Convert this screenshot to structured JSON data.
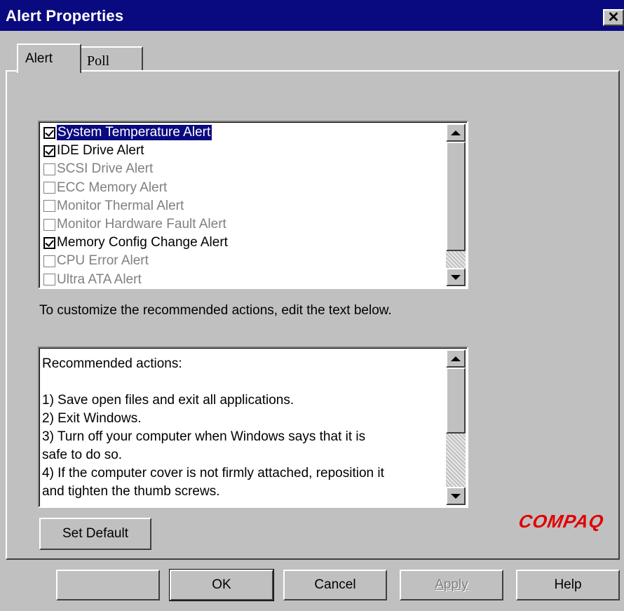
{
  "window": {
    "title": "Alert Properties",
    "close_glyph": "✕"
  },
  "tabs": [
    {
      "label": "Alert",
      "active": true
    },
    {
      "label": "Poll",
      "active": false
    }
  ],
  "alerts": [
    {
      "label": "System Temperature Alert",
      "checked": true,
      "enabled": true,
      "selected": true
    },
    {
      "label": "IDE Drive Alert",
      "checked": true,
      "enabled": true,
      "selected": false
    },
    {
      "label": "SCSI Drive Alert",
      "checked": false,
      "enabled": false,
      "selected": false
    },
    {
      "label": "ECC Memory Alert",
      "checked": false,
      "enabled": false,
      "selected": false
    },
    {
      "label": "Monitor Thermal Alert",
      "checked": false,
      "enabled": false,
      "selected": false
    },
    {
      "label": "Monitor Hardware Fault Alert",
      "checked": false,
      "enabled": false,
      "selected": false
    },
    {
      "label": "Memory Config Change Alert",
      "checked": true,
      "enabled": true,
      "selected": false
    },
    {
      "label": "CPU Error Alert",
      "checked": false,
      "enabled": false,
      "selected": false
    },
    {
      "label": "Ultra ATA Alert",
      "checked": false,
      "enabled": false,
      "selected": false
    }
  ],
  "instruction": "To customize the recommended actions, edit the text below.",
  "actions_lines": [
    "Recommended actions:",
    "",
    "1) Save open files and exit all applications.",
    "2) Exit Windows.",
    "3) Turn off your computer when Windows says that it is",
    "safe to do so.",
    "4) If the computer cover is not firmly attached, reposition it",
    "and tighten the thumb screws."
  ],
  "buttons": {
    "set_default": "Set Default",
    "blank": "",
    "ok": "OK",
    "cancel": "Cancel",
    "apply": "Apply",
    "help": "Help"
  },
  "logo": "COMPAQ",
  "colors": {
    "title_bar": "#0a0a80",
    "selection": "#0a0a80",
    "face": "#c0c0c0",
    "logo": "#e00000"
  }
}
